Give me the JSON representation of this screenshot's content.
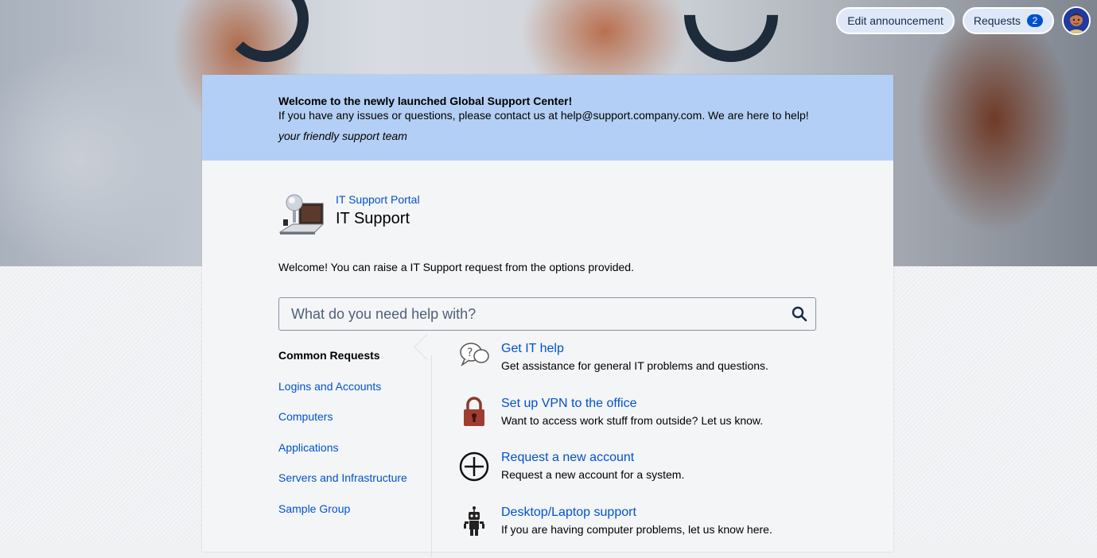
{
  "header": {
    "edit_announcement_label": "Edit announcement",
    "requests_label": "Requests",
    "requests_count": "2"
  },
  "announcement": {
    "title": "Welcome to the newly launched Global Support Center!",
    "body": "If you have any issues or questions, please contact us at help@support.company.com. We are here to help!",
    "signature": "your friendly support team"
  },
  "portal": {
    "breadcrumb": "IT Support Portal",
    "title": "IT Support",
    "welcome": "Welcome! You can raise a IT Support request from the options provided."
  },
  "search": {
    "placeholder": "What do you need help with?"
  },
  "groups": [
    {
      "label": "Common Requests",
      "active": true
    },
    {
      "label": "Logins and Accounts"
    },
    {
      "label": "Computers"
    },
    {
      "label": "Applications"
    },
    {
      "label": "Servers and Infrastructure"
    },
    {
      "label": "Sample Group"
    }
  ],
  "request_types": [
    {
      "icon": "question-bubbles-icon",
      "name": "Get IT help",
      "description": "Get assistance for general IT problems and questions."
    },
    {
      "icon": "padlock-icon",
      "name": "Set up VPN to the office",
      "description": "Want to access work stuff from outside? Let us know."
    },
    {
      "icon": "plus-circle-icon",
      "name": "Request a new account",
      "description": "Request a new account for a system."
    },
    {
      "icon": "robot-icon",
      "name": "Desktop/Laptop support",
      "description": "If you are having computer problems, let us know here."
    }
  ],
  "colors": {
    "accent": "#0052cc",
    "announcement_bg": "#b3cff5",
    "badge": "#0052cc"
  }
}
